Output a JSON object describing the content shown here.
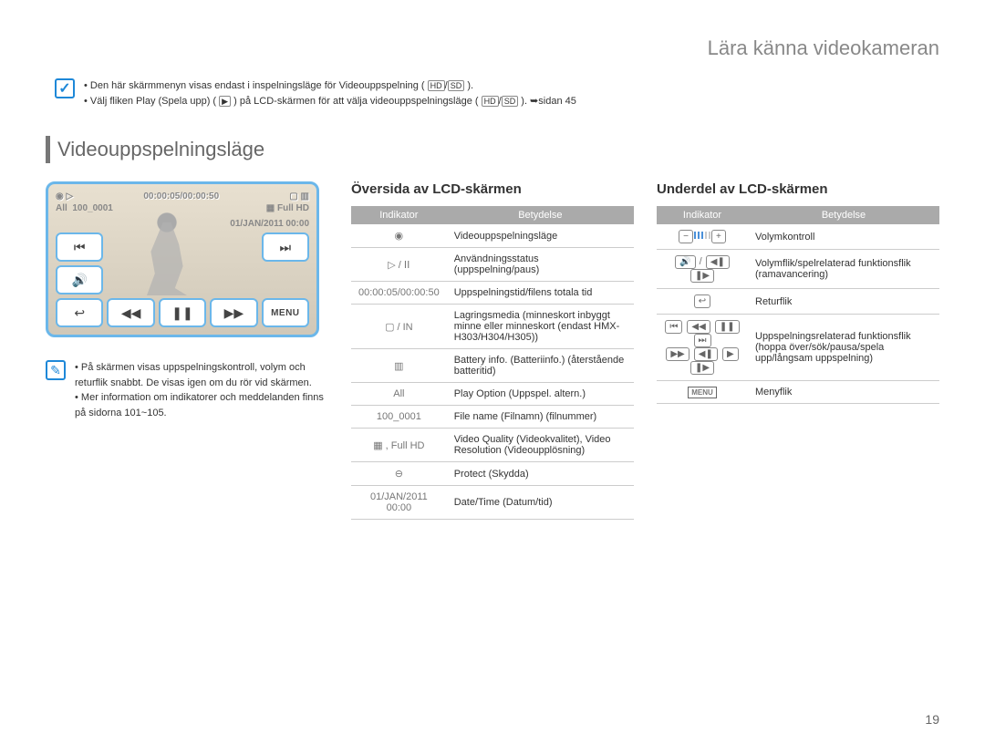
{
  "header": {
    "title": "Lära känna videokameran"
  },
  "info": {
    "line1": "Den här skärmmenyn visas endast i inspelningsläge för Videouppspelning (",
    "line1_end": ").",
    "line2": "Välj fliken Play (Spela upp) (",
    "line2_mid": ") på LCD-skärmen för att välja videouppspelningsläge (",
    "line2_end": "). ➥sidan 45"
  },
  "section": {
    "title": "Videouppspelningsläge"
  },
  "lcd": {
    "time": "00:00:05/00:00:50",
    "file": "100_0001",
    "all_label": "All",
    "date": "01/JAN/2011 00:00",
    "menu": "MENU"
  },
  "notes": {
    "n1": "På skärmen visas uppspelningskontroll, volym och returflik snabbt. De visas igen om du rör vid skärmen.",
    "n2": "Mer information om indikatorer och meddelanden finns på sidorna 101~105."
  },
  "table_top": {
    "heading": "Översida av LCD-skärmen",
    "col1": "Indikator",
    "col2": "Betydelse",
    "rows": [
      {
        "ind_icon": "◉",
        "meaning": "Videouppspelningsläge"
      },
      {
        "ind_text": "▷ / ⅠⅠ",
        "meaning": "Användningsstatus (uppspelning/paus)"
      },
      {
        "ind_text": "00:00:05/00:00:50",
        "meaning": "Uppspelningstid/filens totala tid"
      },
      {
        "ind_icon_pair": "▢ / IN",
        "meaning": "Lagringsmedia (minneskort inbyggt minne eller minneskort (endast HMX-H303/H304/H305))"
      },
      {
        "ind_icon": "▥",
        "meaning": "Battery info. (Batteriinfo.) (återstående batteritid)"
      },
      {
        "ind_text": "All",
        "meaning": "Play Option (Uppspel. altern.)"
      },
      {
        "ind_text": "100_0001",
        "meaning": "File name (Filnamn) (filnummer)"
      },
      {
        "ind_icon_pair": "▦ , Full HD",
        "meaning": "Video Quality (Videokvalitet), Video Resolution (Videoupplösning)"
      },
      {
        "ind_icon": "⊖",
        "meaning": "Protect (Skydda)"
      },
      {
        "ind_text": "01/JAN/2011 00:00",
        "meaning": "Date/Time (Datum/tid)"
      }
    ]
  },
  "table_bottom": {
    "heading": "Underdel av LCD-skärmen",
    "col1": "Indikator",
    "col2": "Betydelse",
    "rows": [
      {
        "ind_type": "volume",
        "meaning": "Volymkontroll"
      },
      {
        "ind_type": "vol_tabs",
        "meaning": "Volymflik/spelrelaterad funktionsflik (ramavancering)"
      },
      {
        "ind_type": "return",
        "meaning": "Returflik"
      },
      {
        "ind_type": "play_tabs",
        "meaning": "Uppspelningsrelaterad funktionsflik (hoppa över/sök/pausa/spela upp/långsam uppspelning)"
      },
      {
        "ind_type": "menu",
        "meaning": "Menyflik"
      }
    ]
  },
  "page_number": "19"
}
